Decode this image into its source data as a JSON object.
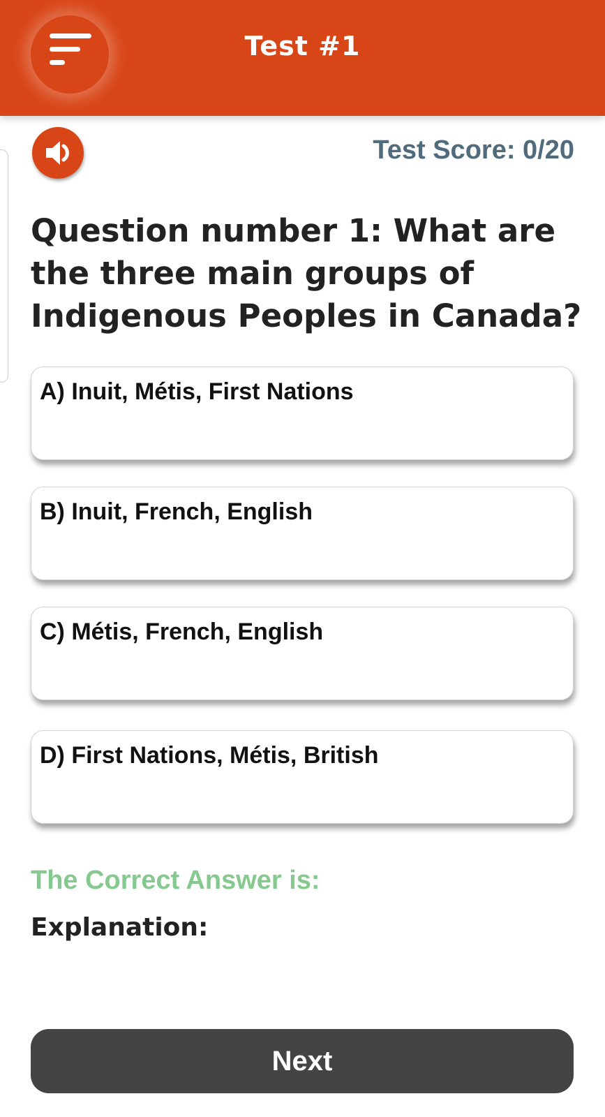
{
  "header": {
    "title": "Test #1",
    "menu_icon": "hamburger-menu-icon",
    "background_color": "#d84516"
  },
  "toolbar": {
    "audio_icon": "speaker-icon",
    "score_label": "Test Score: 0/20"
  },
  "question": {
    "text": "Question number 1: What are the three main groups of Indigenous Peoples in Canada?"
  },
  "options": [
    {
      "label": "A) Inuit, Métis, First Nations"
    },
    {
      "label": "B) Inuit, French, English"
    },
    {
      "label": "C) Métis, French, English"
    },
    {
      "label": "D) First Nations, Métis, British"
    }
  ],
  "result": {
    "correct_label": "The Correct Answer is:",
    "explanation_label": "Explanation:",
    "correct_color": "#86c98f"
  },
  "footer": {
    "next_label": "Next"
  }
}
